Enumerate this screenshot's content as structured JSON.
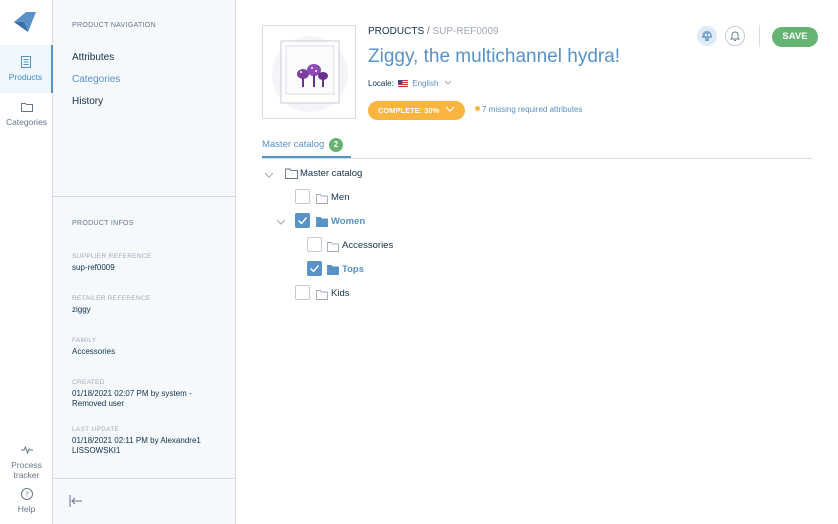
{
  "rail": {
    "items": [
      {
        "label": "Products",
        "icon": "products-icon"
      },
      {
        "label": "Categories",
        "icon": "categories-icon"
      },
      {
        "label": "Process tracker",
        "icon": "activity-icon"
      },
      {
        "label": "Help",
        "icon": "help-icon"
      }
    ]
  },
  "nav": {
    "section_title": "PRODUCT NAVIGATION",
    "links": [
      "Attributes",
      "Categories",
      "History"
    ],
    "infos_title": "PRODUCT INFOS",
    "infos": [
      {
        "key": "SUPPLIER REFERENCE",
        "value": "sup-ref0009"
      },
      {
        "key": "RETAILER REFERENCE",
        "value": "ziggy"
      },
      {
        "key": "FAMILY",
        "value": "Accessories"
      },
      {
        "key": "CREATED",
        "value": "01/18/2021 02:07 PM by system - Removed user"
      },
      {
        "key": "LAST UPDATE",
        "value": "01/18/2021 02:11 PM by Alexandre1 LISSOWSKI1"
      }
    ]
  },
  "header": {
    "breadcrumb_root": "PRODUCTS",
    "breadcrumb_sep": "/",
    "breadcrumb_ref": "SUP-REF0009",
    "title": "Ziggy, the multichannel hydra!",
    "locale_label": "Locale:",
    "locale_value": "English",
    "complete_label": "COMPLETE: 30%",
    "missing_label": "7 missing required attributes",
    "save_label": "SAVE"
  },
  "tabs": [
    {
      "label": "Master catalog",
      "count": "2"
    }
  ],
  "tree": {
    "root": "Master catalog",
    "items": [
      {
        "label": "Men",
        "checked": false
      },
      {
        "label": "Women",
        "checked": true
      },
      {
        "label": "Accessories",
        "checked": false
      },
      {
        "label": "Tops",
        "checked": true
      },
      {
        "label": "Kids",
        "checked": false
      }
    ]
  },
  "colors": {
    "accent": "#5992c7",
    "success": "#67b373",
    "warning": "#f9b53f",
    "text": "#11324d"
  }
}
